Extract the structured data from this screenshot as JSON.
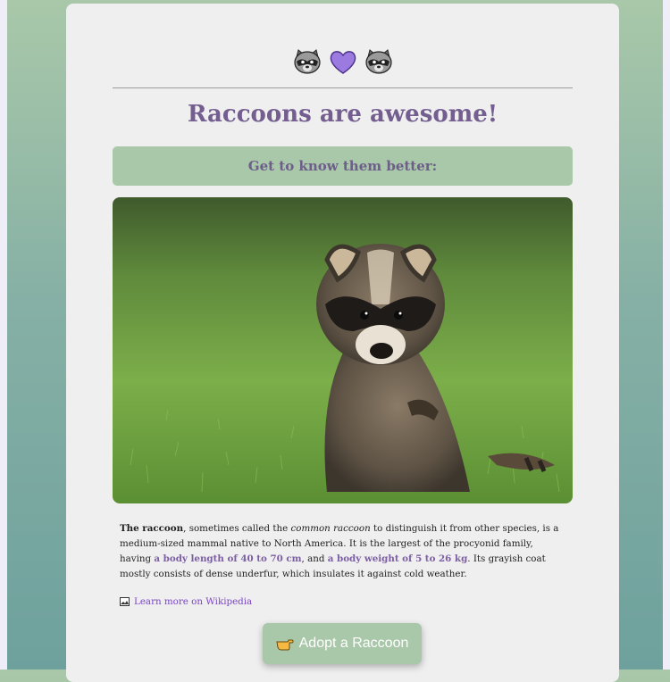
{
  "header": {
    "emoji_icons": [
      "raccoon-icon",
      "purple-heart-icon",
      "raccoon-icon"
    ],
    "title": "Raccoons are awesome!",
    "subtitle": "Get to know them better:"
  },
  "photo": {
    "subject": "raccoon-photo"
  },
  "description": {
    "lead_bold": "The raccoon",
    "text_1": ", sometimes called the ",
    "italic": "common raccoon",
    "text_2": " to distinguish it from other species, is a medium-sized mammal native to North America. It is the largest of the procyonid family, having ",
    "highlight_1": "a body length of 40 to 70 cm",
    "text_3": ", and ",
    "highlight_2": "a body weight of 5 to 26 kg",
    "text_4": ". Its grayish coat mostly consists of dense underfur, which insulates it against cold weather."
  },
  "wiki": {
    "icon": "image-frame-icon",
    "link_text": "Learn more on Wikipedia"
  },
  "adopt": {
    "icon": "pointing-hand-icon",
    "label": "Adopt a Raccoon"
  },
  "colors": {
    "accent_purple": "#735e8f",
    "link_purple": "#7b44c8",
    "sage_green": "#a9c7a9",
    "card_bg": "#efefef"
  }
}
